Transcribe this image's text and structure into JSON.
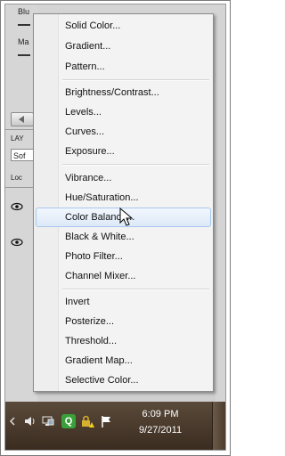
{
  "panel": {
    "label_top": "Blu",
    "label_mid": "Ma",
    "layers_tab": "LAY",
    "blend_mode": "Sof",
    "lock_label": "Loc"
  },
  "menu": {
    "groups": [
      [
        "Solid Color...",
        "Gradient...",
        "Pattern..."
      ],
      [
        "Brightness/Contrast...",
        "Levels...",
        "Curves...",
        "Exposure..."
      ],
      [
        "Vibrance...",
        "Hue/Saturation...",
        "Color Balance...",
        "Black & White...",
        "Photo Filter...",
        "Channel Mixer..."
      ],
      [
        "Invert",
        "Posterize...",
        "Threshold...",
        "Gradient Map...",
        "Selective Color..."
      ]
    ],
    "highlighted": "Color Balance..."
  },
  "taskbar": {
    "time": "6:09 PM",
    "date": "9/27/2011",
    "icons": [
      "speaker-icon",
      "network-icon",
      "q-app-icon",
      "lock-warning-icon",
      "flag-icon"
    ]
  },
  "colors": {
    "highlight_border": "#a8c7ee",
    "menu_bg": "#f3f3f3",
    "taskbar_bg": "#4a3a2c"
  }
}
